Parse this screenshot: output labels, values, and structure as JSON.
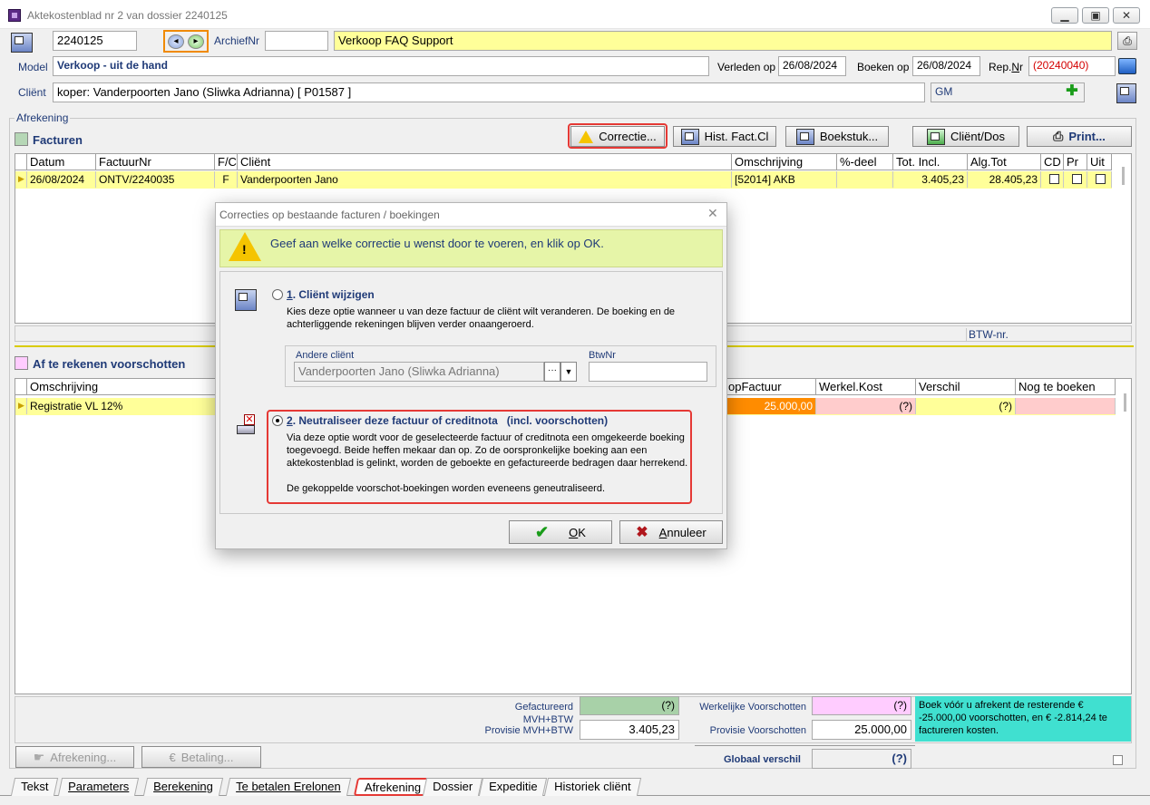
{
  "window": {
    "title": "Aktekostenblad nr 2 van dossier 2240125",
    "minimize": "▁",
    "maximize": "▣",
    "close": "✕"
  },
  "header": {
    "dossier_nr": "2240125",
    "archief_label": "ArchiefNr",
    "archief_value": "",
    "subject": "Verkoop FAQ Support",
    "model_label": "Model",
    "model_value": "Verkoop - uit de hand",
    "verleden_label": "Verleden op",
    "verleden_value": "26/08/2024",
    "boeken_label": "Boeken op",
    "boeken_value": "26/08/2024",
    "rep_label_pre": "Rep.",
    "rep_label_u": "N",
    "rep_label_post": "r",
    "rep_value": "(20240040)",
    "client_label": "Cliënt",
    "client_value": "koper: Vanderpoorten Jano (Sliwka Adrianna) [ P01587 ]",
    "gm_value": "GM"
  },
  "afrekening": {
    "group_label": "Afrekening",
    "facturen_label": "Facturen",
    "buttons": {
      "correctie": "Correctie...",
      "hist": "Hist. Fact.Cl",
      "boekstuk": "Boekstuk...",
      "client_dos": "Cliënt/Dos",
      "print": "Print..."
    },
    "facturen_columns": [
      "Datum",
      "FactuurNr",
      "F/C",
      "Cliënt",
      "Omschrijving",
      "%-deel",
      "Tot. Incl.",
      "Alg.Tot",
      "CD",
      "Pr",
      "Uit"
    ],
    "facturen_rows": [
      {
        "datum": "26/08/2024",
        "factuurnr": "ONTV/2240035",
        "fc": "F",
        "client": "Vanderpoorten Jano",
        "omschrijving": "[52014] AKB",
        "deel": "",
        "tot_incl": "3.405,23",
        "alg_tot": "28.405,23"
      }
    ],
    "btw_label": "BTW-nr.",
    "voorschotten_label": "Af te rekenen voorschotten",
    "voorschot_columns": [
      "Omschrijving",
      "opFactuur",
      "Werkel.Kost",
      "Verschil",
      "Nog te boeken"
    ],
    "voorschot_rows": [
      {
        "omschrijving": "Registratie VL 12%",
        "opfactuur": "25.000,00",
        "werkel": "(?)",
        "verschil": "(?)",
        "nog": ""
      }
    ]
  },
  "totals": {
    "gefactureerd_label": "Gefactureerd MVH+BTW",
    "gefactureerd_value": "(?)",
    "provisie_label": "Provisie MVH+BTW",
    "provisie_value": "3.405,23",
    "werkelijke_label": "Werkelijke Voorschotten",
    "werkelijke_value": "(?)",
    "prov_voorschot_label": "Provisie Voorschotten",
    "prov_voorschot_value": "25.000,00",
    "globaal_label": "Globaal verschil",
    "globaal_value": "(?)",
    "note": "Boek vóór u afrekent de resterende € -25.000,00 voorschotten, en € -2.814,24 te factureren kosten.",
    "afrekening_btn": "Afrekening...",
    "betaling_btn": "Betaling...",
    "euro": "€"
  },
  "tabs": [
    "Tekst",
    "Parameters",
    "Berekening",
    "Te betalen Erelonen",
    "Afrekening",
    "Dossier",
    "Expeditie",
    "Historiek cliënt"
  ],
  "dialog": {
    "title": "Correcties op bestaande facturen / boekingen",
    "close": "✕",
    "instruction": "Geef aan welke correctie u wenst door te voeren, en klik op OK.",
    "option1_num": "1",
    "option1_title": ". Cliënt wijzigen",
    "option1_desc": "Kies deze optie wanneer u van deze factuur de cliënt wilt veranderen. De boeking en de achterliggende rekeningen blijven verder onaangeroerd.",
    "andere_client_label": "Andere cliënt",
    "andere_client_value": "Vanderpoorten Jano (Sliwka Adrianna)",
    "btwnr_label": "BtwNr",
    "btwnr_value": "",
    "option2_num": "2",
    "option2_title": ". Neutraliseer deze factuur of creditnota   (incl. voorschotten)",
    "option2_desc": "Via deze optie wordt voor de geselecteerde factuur of creditnota een omgekeerde boeking toegevoegd. Beide heffen mekaar dan op. Zo de oorspronkelijke boeking aan een aktekostenblad is gelinkt, worden de geboekte en gefactureerde bedragen daar herrekend.",
    "option2_note": "De gekoppelde voorschot-boekingen worden eveneens geneutraliseerd.",
    "ok_u": "O",
    "ok_rest": "K",
    "cancel_u": "A",
    "cancel_rest": "nnuleer"
  },
  "colors": {
    "accent_red": "#e53935",
    "yellow_row": "#ffff99",
    "orange_cell": "#ff8c00",
    "pink_cell": "#ffcccc",
    "note_bg": "#40e0d0"
  }
}
